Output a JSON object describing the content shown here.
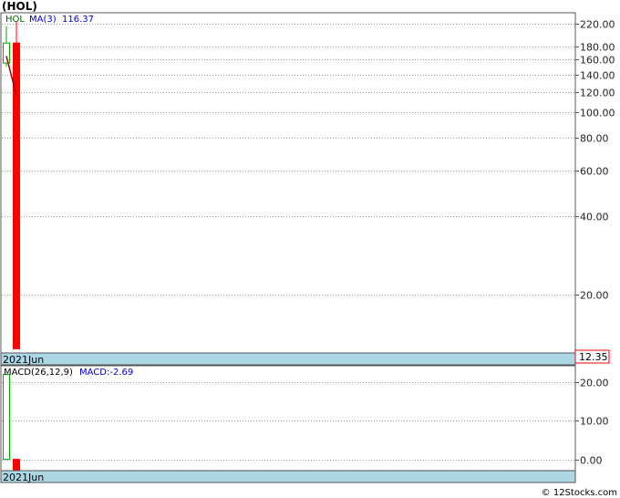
{
  "chart_data": [
    {
      "type": "candlestick",
      "title": "(HOL)",
      "ticker": "HOL",
      "scale": "log",
      "ylim": [
        12,
        240
      ],
      "y_ticks": [
        "220.00",
        "180.00",
        "160.00",
        "140.00",
        "120.00",
        "100.00",
        "80.00",
        "60.00",
        "40.00",
        "20.00"
      ],
      "y_tick_values": [
        220,
        180,
        160,
        140,
        120,
        100,
        80,
        60,
        40,
        20
      ],
      "x_label": "2021Jun",
      "last_price_label": "12.35",
      "series": [
        {
          "name": "HOL",
          "candles": [
            {
              "open": 155,
              "high": 215,
              "low": 150,
              "close": 185,
              "color": "#00aa00",
              "filled": false
            },
            {
              "open": 185,
              "high": 225,
              "low": 12.35,
              "close": 12.35,
              "color": "#ff0000",
              "filled": true
            }
          ]
        },
        {
          "name": "MA(3)",
          "label": "MA(3)",
          "value_label": "116.37",
          "color": "#aa0000",
          "values": [
            165,
            116.37
          ]
        }
      ],
      "grid": true
    },
    {
      "type": "bar",
      "title": "MACD(26,12,9)",
      "value_label": "MACD:-2.69",
      "ylim": [
        -2.69,
        24
      ],
      "y_ticks": [
        "20.00",
        "10.00",
        "0.00"
      ],
      "y_tick_values": [
        20,
        10,
        0
      ],
      "x_label": "2021Jun",
      "series": [
        {
          "name": "MACD",
          "values": [
            22,
            -2.69
          ],
          "colors": [
            "#00aa00",
            "#ff0000"
          ]
        }
      ],
      "grid": true
    }
  ],
  "colors": {
    "up": "#00aa00",
    "down": "#ff0000",
    "ma": "#aa0000",
    "legend_label": "#0000cc",
    "date_bar": "#acd8e6",
    "price_box": "#ffffff"
  },
  "credit": "© 12Stocks.com"
}
